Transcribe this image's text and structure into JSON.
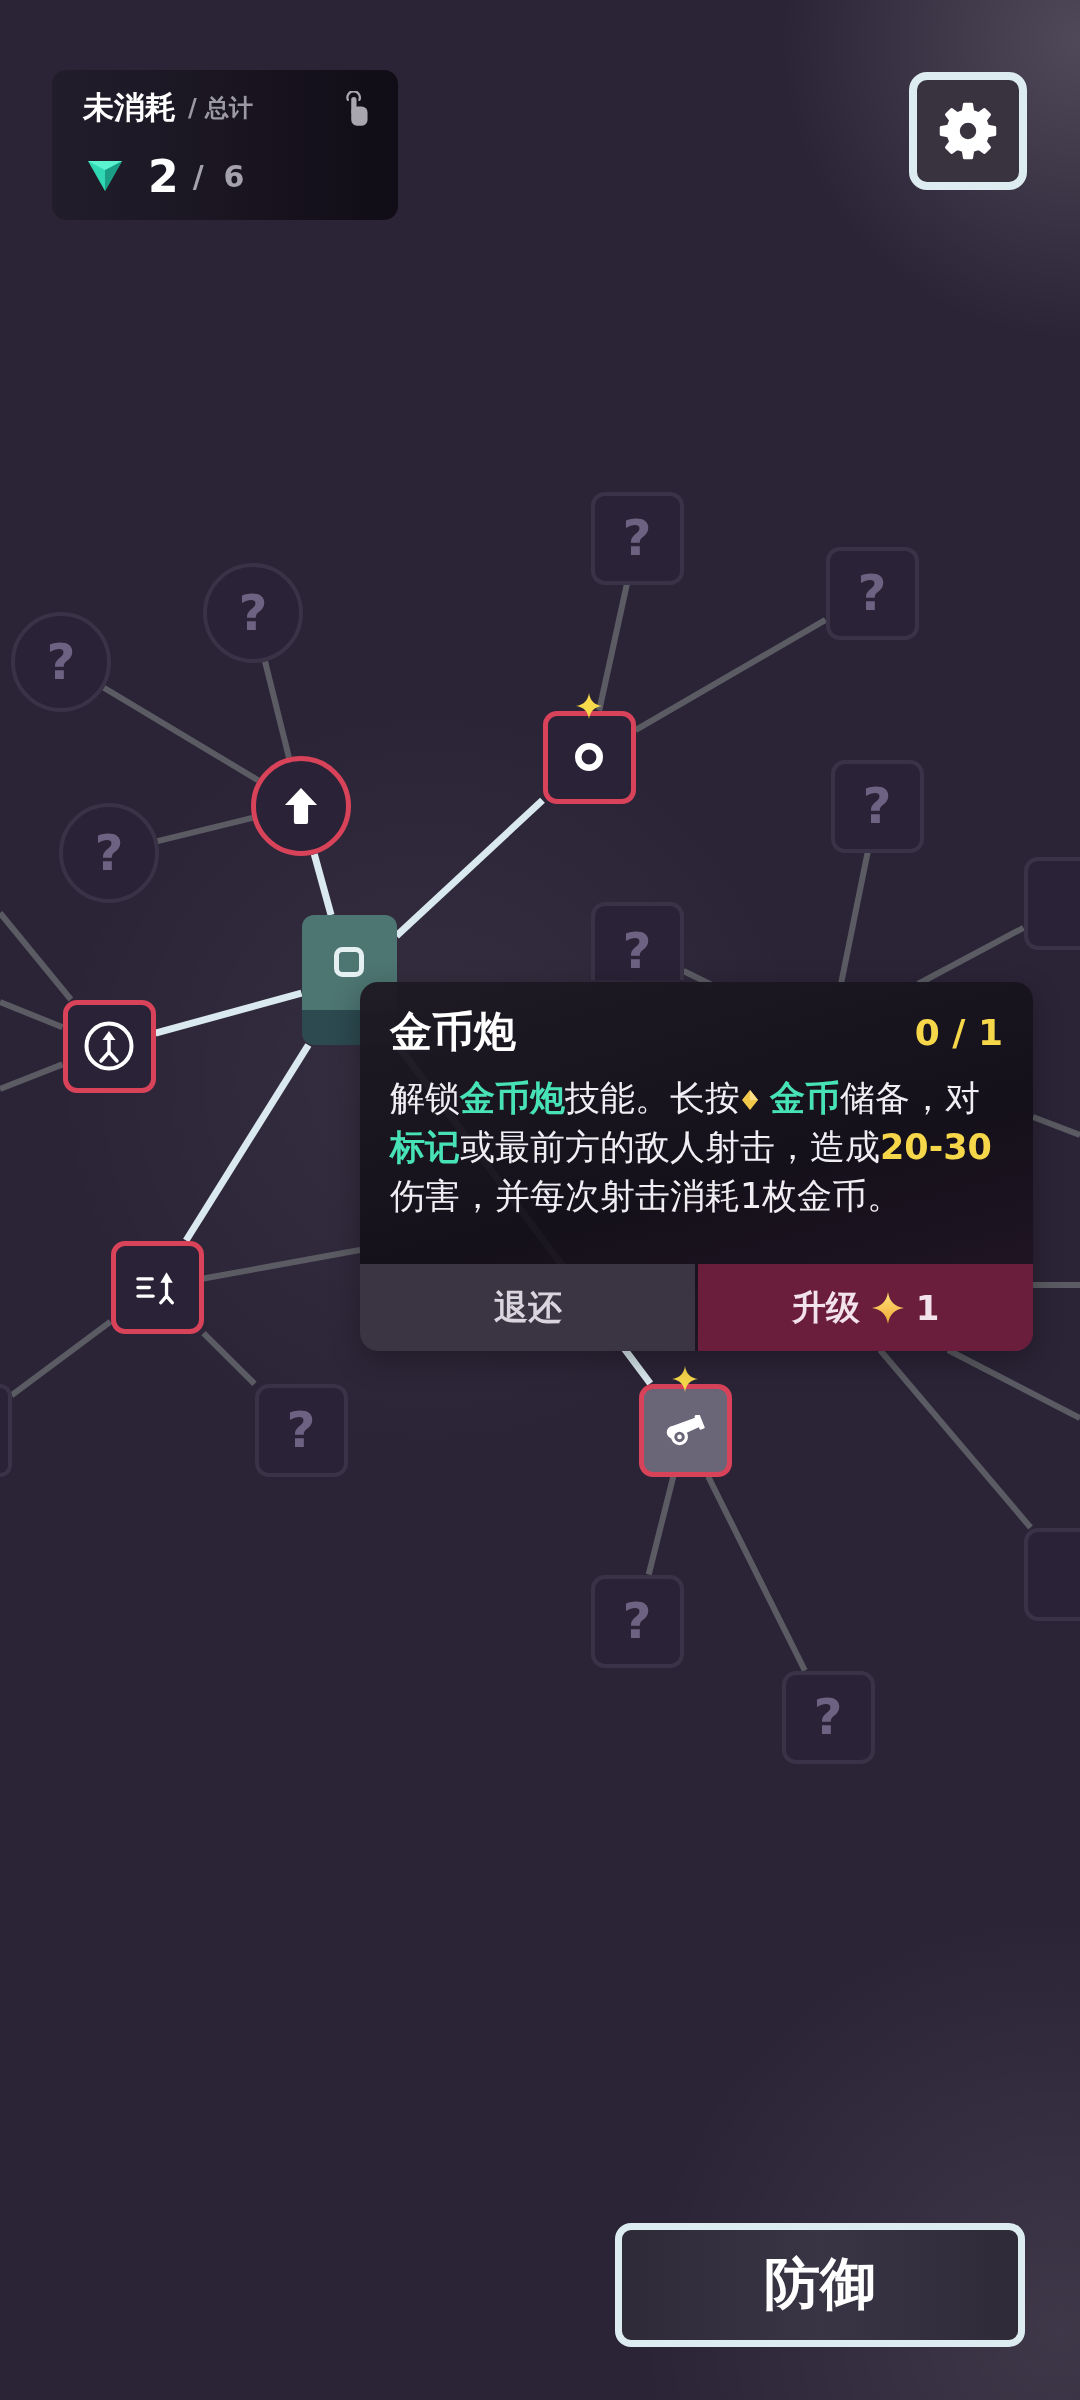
{
  "resources": {
    "label": "未消耗",
    "sublabel": "/ 总计",
    "unspent": "2",
    "separator": "/",
    "total": "6"
  },
  "skill_tree": {
    "kind": "root",
    "selected": false,
    "upgradable": false,
    "children": [
      {
        "kind": "skill",
        "unlocked": true,
        "selected": false,
        "upgradable": false,
        "children": [
          {
            "kind": "unknown",
            "label": "?",
            "unlocked": false,
            "selected": false,
            "upgradable": false
          },
          {
            "kind": "unknown",
            "label": "?",
            "unlocked": false,
            "selected": false,
            "upgradable": false
          },
          {
            "kind": "unknown",
            "label": "?",
            "unlocked": false,
            "selected": false,
            "upgradable": false
          }
        ]
      },
      {
        "kind": "skill",
        "unlocked": true,
        "selected": false,
        "upgradable": true,
        "children": [
          {
            "kind": "unknown",
            "label": "?",
            "unlocked": false,
            "selected": false,
            "upgradable": false
          },
          {
            "kind": "unknown",
            "label": "?",
            "unlocked": false,
            "selected": false,
            "upgradable": false
          }
        ]
      },
      {
        "kind": "skill",
        "unlocked": true,
        "selected": false,
        "upgradable": false
      },
      {
        "kind": "skill",
        "unlocked": true,
        "selected": false,
        "upgradable": false,
        "children": [
          {
            "kind": "unknown",
            "label": "?",
            "unlocked": false,
            "selected": false,
            "upgradable": false
          },
          {
            "kind": "unknown",
            "unlocked": false,
            "selected": false,
            "upgradable": false
          }
        ]
      },
      {
        "kind": "skill",
        "unlocked": true,
        "selected": true,
        "upgradable": true,
        "children": [
          {
            "kind": "unknown",
            "label": "?",
            "unlocked": false,
            "selected": false,
            "upgradable": false
          },
          {
            "kind": "unknown",
            "label": "?",
            "unlocked": false,
            "selected": false,
            "upgradable": false
          }
        ]
      }
    ]
  },
  "other_nodes": [
    {
      "kind": "unknown",
      "label": "?",
      "unlocked": false,
      "selected": false,
      "upgradable": false
    },
    {
      "kind": "unknown",
      "unlocked": false,
      "selected": false,
      "upgradable": false
    },
    {
      "kind": "unknown",
      "label": "?",
      "unlocked": false,
      "selected": false,
      "upgradable": false
    },
    {
      "kind": "unknown",
      "unlocked": false,
      "selected": false,
      "upgradable": false
    }
  ],
  "detail_card": {
    "title": "金币炮",
    "rank": "0 / 1",
    "description": [
      {
        "kind": "plain",
        "text": "解锁"
      },
      {
        "kind": "keyword",
        "text": "金币炮"
      },
      {
        "kind": "plain",
        "text": "技能。长按"
      },
      {
        "kind": "coin",
        "text": "金币"
      },
      {
        "kind": "plain",
        "text": "储备，对"
      },
      {
        "kind": "keyword",
        "text": "标记"
      },
      {
        "kind": "plain",
        "text": "或最前方的敌人射击，造成"
      },
      {
        "kind": "number",
        "text": "20-30"
      },
      {
        "kind": "plain",
        "text": "伤害，并每次射击消耗1枚金币。"
      }
    ],
    "refund_button": {
      "label": "退还"
    },
    "upgrade_button": {
      "label": "升级",
      "cost": "1"
    }
  },
  "defend_button": {
    "label": "防御"
  }
}
